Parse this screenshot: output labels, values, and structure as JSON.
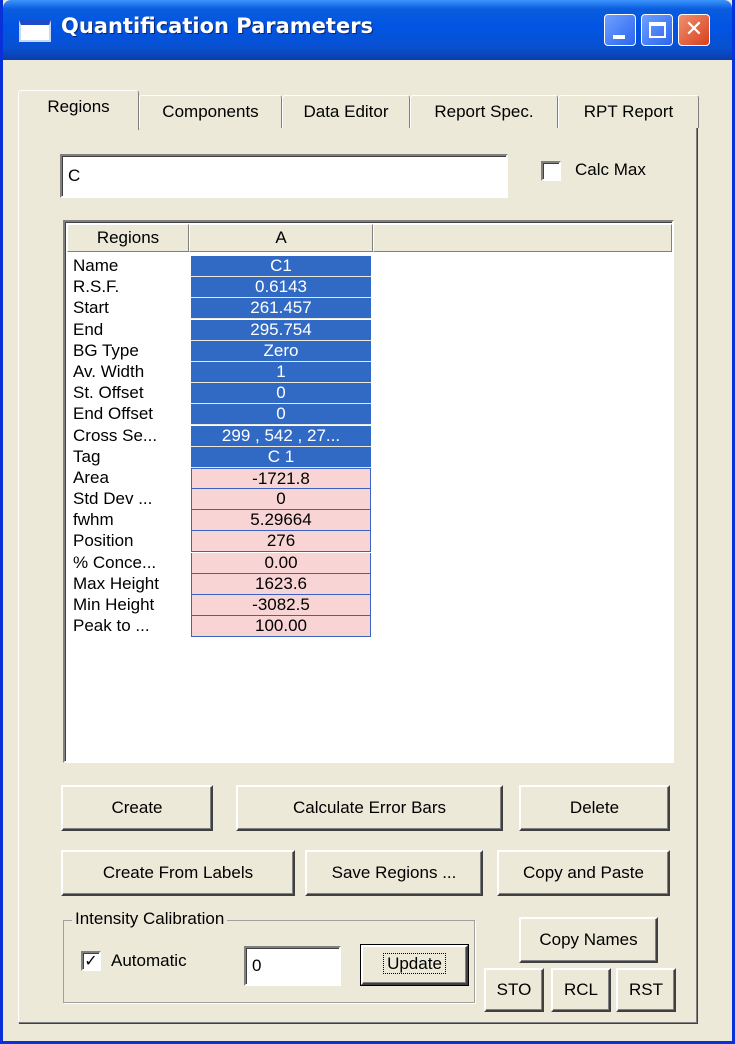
{
  "window": {
    "title": "Quantification Parameters"
  },
  "tabs": [
    "Regions",
    "Components",
    "Data Editor",
    "Report Spec.",
    "RPT Report"
  ],
  "name_input": {
    "value": "C"
  },
  "calc_max": {
    "label": "Calc Max",
    "checked": false
  },
  "grid": {
    "columns": [
      "Regions",
      "A",
      ""
    ],
    "rows": [
      {
        "label": "Name",
        "value": "C1"
      },
      {
        "label": "R.S.F.",
        "value": "0.6143"
      },
      {
        "label": "Start",
        "value": "261.457"
      },
      {
        "label": "End",
        "value": "295.754"
      },
      {
        "label": "BG Type",
        "value": "Zero"
      },
      {
        "label": "Av. Width",
        "value": "1"
      },
      {
        "label": "St. Offset",
        "value": "0"
      },
      {
        "label": "End Offset",
        "value": "0"
      },
      {
        "label": "Cross Se...",
        "value": "299 , 542 , 27..."
      },
      {
        "label": "Tag",
        "value": "C 1"
      },
      {
        "label": "Area",
        "value": "-1721.8"
      },
      {
        "label": "Std Dev ...",
        "value": "0"
      },
      {
        "label": "fwhm",
        "value": "5.29664"
      },
      {
        "label": "Position",
        "value": "276"
      },
      {
        "label": "% Conce...",
        "value": "0.00"
      },
      {
        "label": "Max Height",
        "value": "1623.6"
      },
      {
        "label": "Min Height",
        "value": "-3082.5"
      },
      {
        "label": "Peak to ...",
        "value": "100.00"
      }
    ]
  },
  "buttons": {
    "create": "Create",
    "calculate_error_bars": "Calculate Error Bars",
    "delete": "Delete",
    "create_from_labels": "Create From Labels",
    "save_regions": "Save Regions ...",
    "copy_and_paste": "Copy and Paste",
    "copy_names": "Copy Names",
    "update": "Update",
    "sto": "STO",
    "rcl": "RCL",
    "rst": "RST"
  },
  "intensity_calibration": {
    "title": "Intensity Calibration",
    "automatic_label": "Automatic",
    "automatic_checked": true,
    "value": "0"
  },
  "colors": {
    "selected": "#316ac5",
    "output": "#f8d4d4",
    "titlebar": "#0054e3"
  }
}
